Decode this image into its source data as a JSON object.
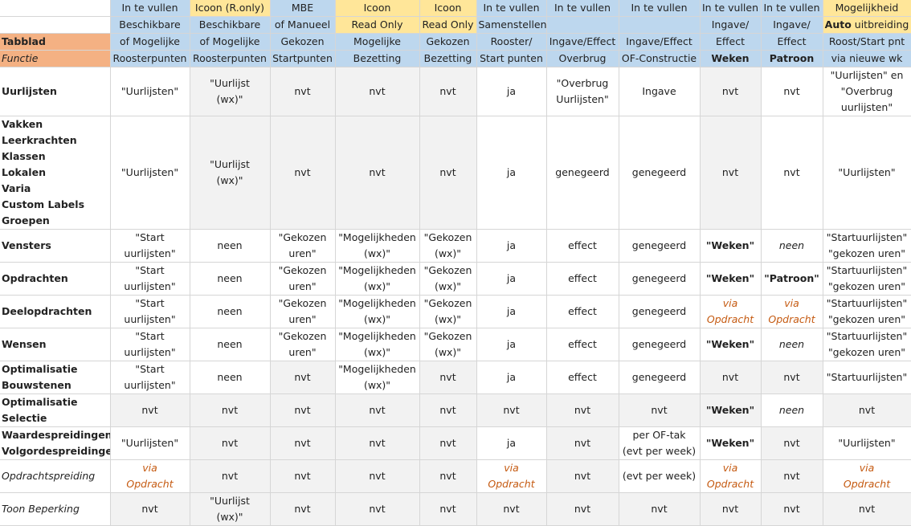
{
  "header": {
    "corner_top": "",
    "tabblad": "Tabblad",
    "functie": "Functie",
    "columns": [
      {
        "l1": "In te vullen",
        "l2": "Beschikbare",
        "l3": "of Mogelijke",
        "l4": "Roosterpunten"
      },
      {
        "l1": "Icoon (R.only)",
        "l2": "Beschikbare",
        "l3": "of Mogelijke",
        "l4": "Roosterpunten"
      },
      {
        "l1": "MBE",
        "l2": "of Manueel",
        "l3": "Gekozen",
        "l4": "Startpunten"
      },
      {
        "l1": "Icoon",
        "l2": "Read Only",
        "l3": "Mogelijke",
        "l4": "Bezetting"
      },
      {
        "l1": "Icoon",
        "l2": "Read Only",
        "l3": "Gekozen",
        "l4": "Bezetting"
      },
      {
        "l1": "In te vullen",
        "l2": "Samenstellen",
        "l3": "Rooster/",
        "l4": "Start punten"
      },
      {
        "l1": "In te vullen",
        "l2": "",
        "l3": "Ingave/Effect",
        "l4": "Overbrug"
      },
      {
        "l1": "In te vullen",
        "l2": "",
        "l3": "Ingave/Effect",
        "l4": "OF-Constructie"
      },
      {
        "l1": "In te vullen",
        "l2": "Ingave/",
        "l3": "Effect",
        "l4": "Weken"
      },
      {
        "l1": "In te vullen",
        "l2": "Ingave/",
        "l3": "Effect",
        "l4": "Patroon"
      },
      {
        "l1": "Mogelijkheid",
        "l2a": "Auto",
        "l2b": " uitbreiding",
        "l3": "Roost/Start pnt",
        "l4": "via nieuwe wk"
      }
    ]
  },
  "rows": [
    {
      "label": [
        "Uurlijsten"
      ],
      "cells": [
        [
          "\"Uurlijsten\""
        ],
        [
          "\"Uurlijst",
          "(wx)\""
        ],
        [
          "nvt"
        ],
        [
          "nvt"
        ],
        [
          "nvt"
        ],
        [
          "ja"
        ],
        [
          "\"Overbrug",
          "Uurlijsten\""
        ],
        [
          "Ingave"
        ],
        [
          "nvt"
        ],
        [
          "nvt"
        ],
        [
          "\"Uurlijsten\" en",
          "\"Overbrug",
          "uurlijsten\""
        ]
      ]
    },
    {
      "label": [
        "Vakken",
        "Leerkrachten",
        "Klassen",
        "Lokalen",
        "Varia",
        "Custom Labels",
        "Groepen"
      ],
      "cells": [
        [
          "\"Uurlijsten\""
        ],
        [
          "\"Uurlijst",
          "(wx)\""
        ],
        [
          "nvt"
        ],
        [
          "nvt"
        ],
        [
          "nvt"
        ],
        [
          "ja"
        ],
        [
          "genegeerd"
        ],
        [
          "genegeerd"
        ],
        [
          "nvt"
        ],
        [
          "nvt"
        ],
        [
          "\"Uurlijsten\""
        ]
      ]
    },
    {
      "label": [
        "Vensters"
      ],
      "cells": [
        [
          "\"Start",
          "uurlijsten\""
        ],
        [
          "neen"
        ],
        [
          "\"Gekozen",
          "uren\""
        ],
        [
          "\"Mogelijkheden",
          "(wx)\""
        ],
        [
          "\"Gekozen",
          "(wx)\""
        ],
        [
          "ja"
        ],
        [
          "effect"
        ],
        [
          "genegeerd"
        ],
        [
          "\"Weken\""
        ],
        [
          "neen"
        ],
        [
          "\"Startuurlijsten\"",
          "\"gekozen uren\""
        ]
      ]
    },
    {
      "label": [
        "Opdrachten"
      ],
      "cells": [
        [
          "\"Start",
          "uurlijsten\""
        ],
        [
          "neen"
        ],
        [
          "\"Gekozen",
          "uren\""
        ],
        [
          "\"Mogelijkheden",
          "(wx)\""
        ],
        [
          "\"Gekozen",
          "(wx)\""
        ],
        [
          "ja"
        ],
        [
          "effect"
        ],
        [
          "genegeerd"
        ],
        [
          "\"Weken\""
        ],
        [
          "\"Patroon\""
        ],
        [
          "\"Startuurlijsten\"",
          "\"gekozen uren\""
        ]
      ]
    },
    {
      "label": [
        "Deelopdrachten"
      ],
      "cells": [
        [
          "\"Start",
          "uurlijsten\""
        ],
        [
          "neen"
        ],
        [
          "\"Gekozen",
          "uren\""
        ],
        [
          "\"Mogelijkheden",
          "(wx)\""
        ],
        [
          "\"Gekozen",
          "(wx)\""
        ],
        [
          "ja"
        ],
        [
          "effect"
        ],
        [
          "genegeerd"
        ],
        [
          "via",
          "Opdracht"
        ],
        [
          "via",
          "Opdracht"
        ],
        [
          "\"Startuurlijsten\"",
          "\"gekozen uren\""
        ]
      ]
    },
    {
      "label": [
        "Wensen"
      ],
      "cells": [
        [
          "\"Start",
          "uurlijsten\""
        ],
        [
          "neen"
        ],
        [
          "\"Gekozen",
          "uren\""
        ],
        [
          "\"Mogelijkheden",
          "(wx)\""
        ],
        [
          "\"Gekozen",
          "(wx)\""
        ],
        [
          "ja"
        ],
        [
          "effect"
        ],
        [
          "genegeerd"
        ],
        [
          "\"Weken\""
        ],
        [
          "neen"
        ],
        [
          "\"Startuurlijsten\"",
          "\"gekozen uren\""
        ]
      ]
    },
    {
      "label": [
        "Optimalisatie",
        "Bouwstenen"
      ],
      "cells": [
        [
          "\"Start",
          "uurlijsten\""
        ],
        [
          "neen"
        ],
        [
          "nvt"
        ],
        [
          "\"Mogelijkheden",
          "(wx)\""
        ],
        [
          "nvt"
        ],
        [
          "ja"
        ],
        [
          "effect"
        ],
        [
          "genegeerd"
        ],
        [
          "nvt"
        ],
        [
          "nvt"
        ],
        [
          "\"Startuurlijsten\""
        ]
      ]
    },
    {
      "label": [
        "Optimalisatie",
        "Selectie"
      ],
      "cells": [
        [
          "nvt"
        ],
        [
          "nvt"
        ],
        [
          "nvt"
        ],
        [
          "nvt"
        ],
        [
          "nvt"
        ],
        [
          "nvt"
        ],
        [
          "nvt"
        ],
        [
          "nvt"
        ],
        [
          "\"Weken\""
        ],
        [
          "neen"
        ],
        [
          "nvt"
        ]
      ]
    },
    {
      "label": [
        "Waardespreidingen",
        "Volgordespreidingen"
      ],
      "cells": [
        [
          "\"Uurlijsten\""
        ],
        [
          "nvt"
        ],
        [
          "nvt"
        ],
        [
          "nvt"
        ],
        [
          "nvt"
        ],
        [
          "ja"
        ],
        [
          "nvt"
        ],
        [
          "per OF-tak",
          "(evt per week)"
        ],
        [
          "\"Weken\""
        ],
        [
          "nvt"
        ],
        [
          "\"Uurlijsten\""
        ]
      ]
    },
    {
      "label": [
        "Opdrachtspreiding"
      ],
      "cells": [
        [
          "via",
          "Opdracht"
        ],
        [
          "nvt"
        ],
        [
          "nvt"
        ],
        [
          "nvt"
        ],
        [
          "nvt"
        ],
        [
          "via",
          "Opdracht"
        ],
        [
          "nvt"
        ],
        [
          "(evt per week)"
        ],
        [
          "via",
          "Opdracht"
        ],
        [
          "nvt"
        ],
        [
          "via",
          "Opdracht"
        ]
      ]
    },
    {
      "label": [
        "Toon Beperking"
      ],
      "cells": [
        [
          "nvt"
        ],
        [
          "\"Uurlijst",
          "(wx)\""
        ],
        [
          "nvt"
        ],
        [
          "nvt"
        ],
        [
          "nvt"
        ],
        [
          "nvt"
        ],
        [
          "nvt"
        ],
        [
          "nvt"
        ],
        [
          "nvt"
        ],
        [
          "nvt"
        ],
        [
          "nvt"
        ]
      ]
    }
  ]
}
